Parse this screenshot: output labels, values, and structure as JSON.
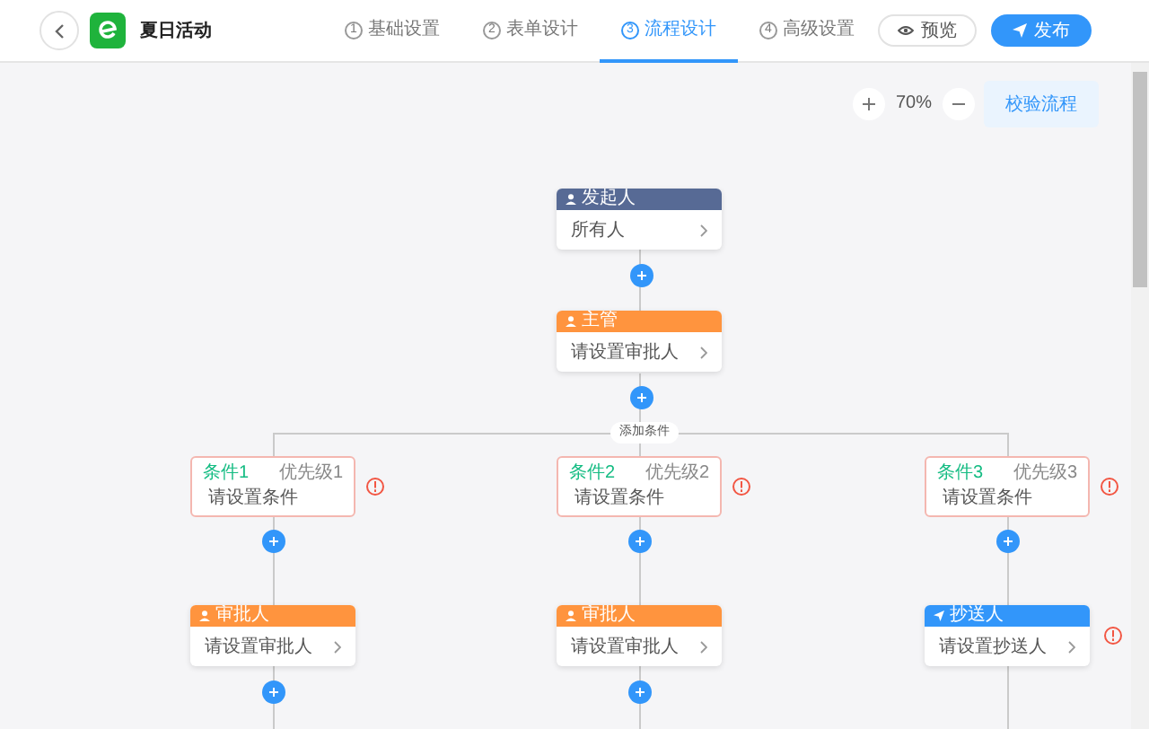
{
  "header": {
    "title": "夏日活动",
    "steps": [
      {
        "number": "1",
        "label": "基础设置",
        "selected": false
      },
      {
        "number": "2",
        "label": "表单设计",
        "selected": false
      },
      {
        "number": "3",
        "label": "流程设计",
        "selected": true
      },
      {
        "number": "4",
        "label": "高级设置",
        "selected": false
      }
    ],
    "buttons": [
      {
        "kind": "preview",
        "label": "预览"
      },
      {
        "kind": "publish",
        "label": "发布"
      }
    ]
  },
  "toolbar": {
    "zoom_level": "70%",
    "validate_button": "校验流程"
  },
  "flow": {
    "nodes": [
      {
        "kind": "initiator",
        "title": "发起人",
        "content": "所有人",
        "error": false
      },
      {
        "kind": "approver",
        "title": "主管",
        "content": "请设置审批人",
        "error": false
      }
    ],
    "add_condition": "添加条件",
    "branches": [
      {
        "condition": {
          "title": "条件1",
          "priority": "优先级1",
          "content": "请设置条件",
          "error": true
        },
        "node": {
          "kind": "approver",
          "title": "审批人",
          "content": "请设置审批人",
          "error": false
        }
      },
      {
        "condition": {
          "title": "条件2",
          "priority": "优先级2",
          "content": "请设置条件",
          "error": true
        },
        "node": {
          "kind": "approver",
          "title": "审批人",
          "content": "请设置审批人",
          "error": false
        }
      },
      {
        "condition": {
          "title": "条件3",
          "priority": "优先级3",
          "content": "请设置条件",
          "error": true
        },
        "node": {
          "kind": "cc",
          "title": "抄送人",
          "content": "请设置抄送人",
          "error": true
        }
      }
    ]
  }
}
